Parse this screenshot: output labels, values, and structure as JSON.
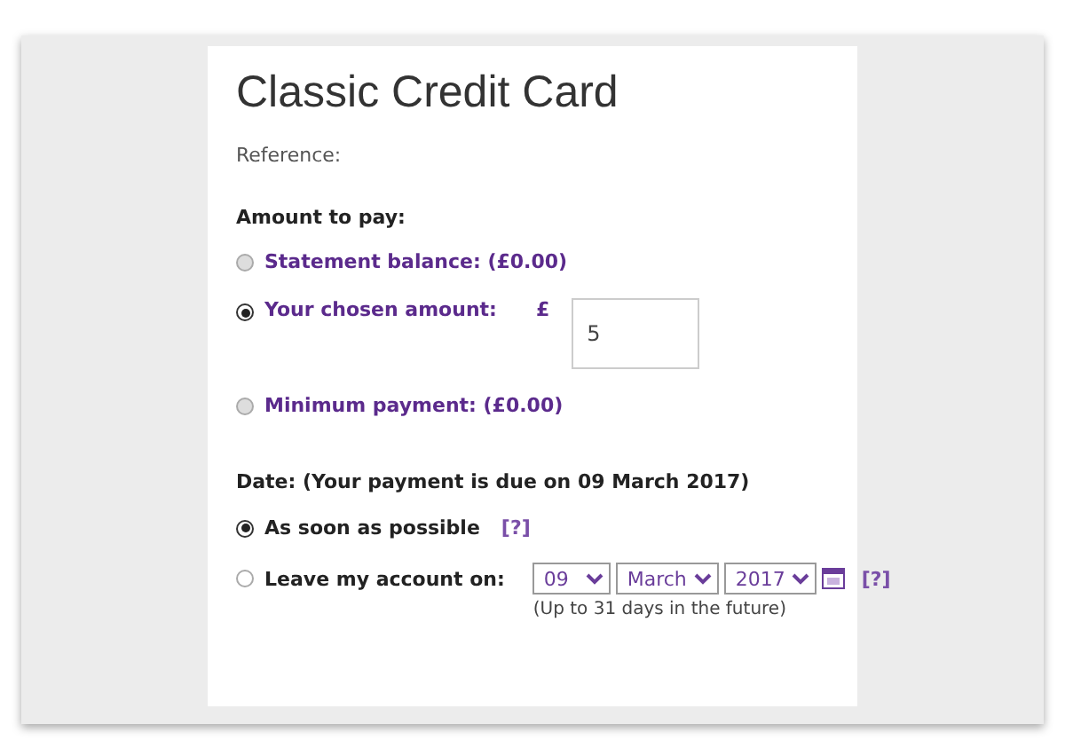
{
  "title": "Classic Credit Card",
  "reference_label": "Reference:",
  "amount_heading": "Amount to pay:",
  "amount_options": [
    {
      "kind": "plain",
      "label": "Statement balance: (£0.00)",
      "selected": false
    },
    {
      "kind": "input",
      "label": "Your chosen amount:",
      "currency": "£",
      "value": "5",
      "selected": true
    },
    {
      "kind": "plain",
      "label": "Minimum payment: (£0.00)",
      "selected": false
    }
  ],
  "date_heading": "Date: (Your payment is due on 09 March 2017)",
  "date_options": [
    {
      "kind": "help",
      "label": "As soon as possible",
      "help": "[?]",
      "selected": true
    },
    {
      "kind": "date",
      "label": "Leave my account on:",
      "day": "09",
      "month": "March",
      "year": "2017",
      "help": "[?]",
      "note": "(Up to 31 days in the future)",
      "selected": false
    }
  ]
}
